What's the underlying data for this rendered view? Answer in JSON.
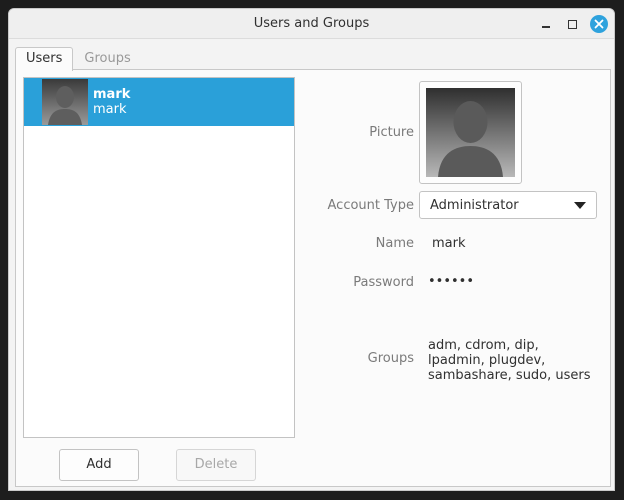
{
  "window": {
    "title": "Users and Groups"
  },
  "tabs": [
    {
      "label": "Users"
    },
    {
      "label": "Groups"
    }
  ],
  "users": [
    {
      "name": "mark",
      "username": "mark"
    }
  ],
  "buttons": {
    "add": "Add",
    "delete": "Delete"
  },
  "details": {
    "picture_label": "Picture",
    "account_type_label": "Account Type",
    "account_type_value": "Administrator",
    "name_label": "Name",
    "name_value": "mark",
    "password_label": "Password",
    "password_value": "••••••",
    "groups_label": "Groups",
    "groups_value": "adm, cdrom, dip, lpadmin, plugdev, sambashare, sudo, users"
  },
  "colors": {
    "selection": "#2aa0d9",
    "close_button": "#2ea2dd"
  },
  "icons": [
    "minimize-icon",
    "maximize-icon",
    "close-icon",
    "avatar-placeholder-icon",
    "dropdown-arrow-icon"
  ]
}
